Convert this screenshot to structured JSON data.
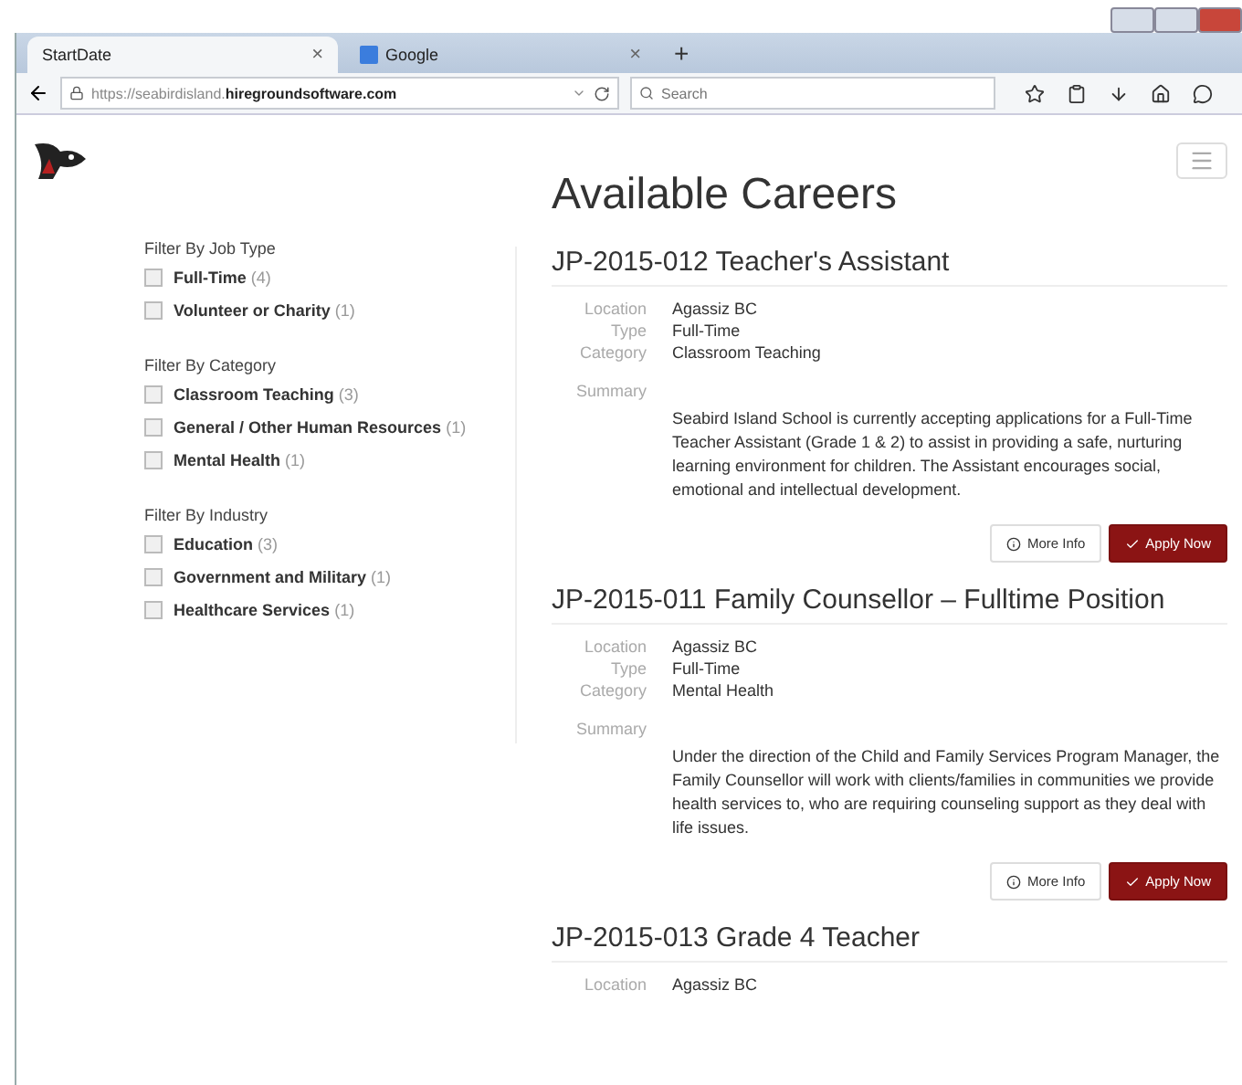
{
  "browser": {
    "tabs": [
      {
        "title": "StartDate",
        "close": "×",
        "selected": true
      },
      {
        "title": "Google",
        "close": "×",
        "selected": false
      }
    ],
    "new_tab": "+",
    "url": "https://seabirdisland.**hiregroundsoftware.com**",
    "search": {
      "placeholder": "Search"
    }
  },
  "page": {
    "title": "Available Careers",
    "filters": [
      {
        "heading": "Filter By Job Type",
        "options": [
          {
            "label": "Full-Time",
            "count": "(4)",
            "checked": false
          },
          {
            "label": "Volunteer or Charity",
            "count": "(1)",
            "checked": false
          }
        ]
      },
      {
        "heading": "Filter By Category",
        "options": [
          {
            "label": "Classroom Teaching",
            "count": "(3)",
            "checked": false
          },
          {
            "label": "General / Other Human Resources",
            "count": "(1)",
            "checked": false
          },
          {
            "label": "Mental Health",
            "count": "(1)",
            "checked": false
          }
        ]
      },
      {
        "heading": "Filter By Industry",
        "options": [
          {
            "label": "Education",
            "count": "(3)",
            "checked": false
          },
          {
            "label": "Government and Military",
            "count": "(1)",
            "checked": false
          },
          {
            "label": "Healthcare Services",
            "count": "(1)",
            "checked": false
          }
        ]
      }
    ],
    "jobs": [
      {
        "title": "JP-2015-012 Teacher's Assistant",
        "details": [
          {
            "label": "Location",
            "value": "Agassiz BC"
          },
          {
            "label": "Type",
            "value": "Full-Time"
          },
          {
            "label": "Category",
            "value": "Classroom Teaching"
          }
        ],
        "summary_label": "Summary",
        "summary": "Seabird Island School is currently accepting applications for a Full-Time Teacher Assistant (Grade 1 & 2) to assist in providing a safe, nurturing learning environment for children. The Assistant encourages social, emotional and intellectual development.",
        "buttons": [
          "More Info",
          "Apply Now"
        ]
      },
      {
        "title": "JP-2015-011 Family Counsellor – Fulltime Position",
        "details": [
          {
            "label": "Location",
            "value": "Agassiz BC"
          },
          {
            "label": "Type",
            "value": "Full-Time"
          },
          {
            "label": "Category",
            "value": "Mental Health"
          }
        ],
        "summary_label": "Summary",
        "summary": "Under the direction of the Child and Family Services Program Manager, the Family Counsellor will work with clients/families in communities we provide health services to, who are requiring counseling support as they deal with life issues.",
        "buttons": [
          "More Info",
          "Apply Now"
        ]
      },
      {
        "title": "JP-2015-013 Grade 4 Teacher",
        "details": [
          {
            "label": "Location",
            "value": "Agassiz BC"
          }
        ]
      }
    ]
  }
}
